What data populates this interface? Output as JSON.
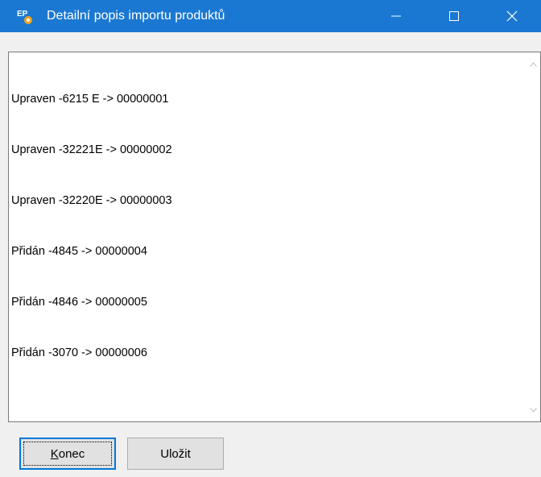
{
  "window": {
    "title": "Detailní popis importu produktů",
    "titlebar_color": "#1a78d2",
    "icon_text": "EP"
  },
  "log": {
    "lines": [
      "Upraven -6215 E -> 00000001",
      "Upraven -32221E -> 00000002",
      "Upraven -32220E -> 00000003",
      "Přidán -4845 -> 00000004",
      "Přidán -4846 -> 00000005",
      "Přidán -3070 -> 00000006"
    ]
  },
  "buttons": {
    "konec_label": "Konec",
    "ulozit_label": "Uložit",
    "focus_color": "#0078d7"
  }
}
